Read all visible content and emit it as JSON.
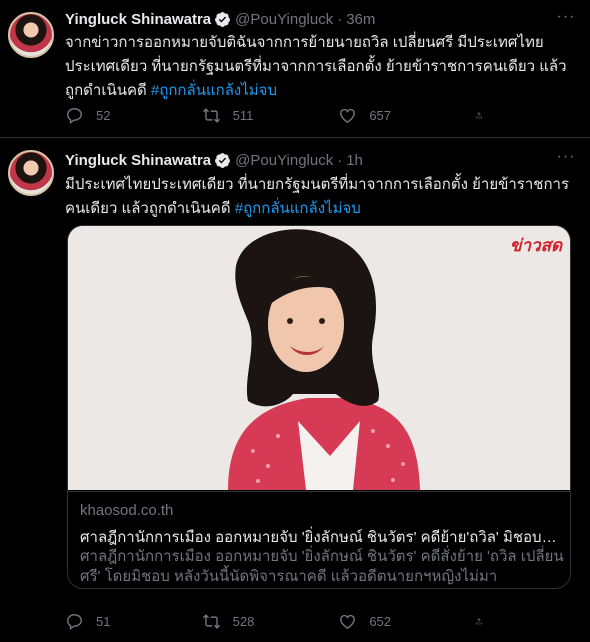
{
  "tweets": [
    {
      "name": "Yingluck Shinawatra",
      "handle": "@PouYingluck",
      "separator": "·",
      "time": "36m",
      "text": "จากข่าวการออกหมายจับติฉันจากการย้ายนายถวิล เปลี่ยนศรี มีประเทศไทยประเทศเดียว ที่นายกรัฐมนตรีที่มาจากการเลือกตั้ง ย้ายข้าราชการคนเดียว แล้วถูกดำเนินคดี",
      "hashtag": "#ถูกกลั่นแกล้งไม่จบ",
      "stats": {
        "replies": "52",
        "retweets": "511",
        "likes": "657"
      }
    },
    {
      "name": "Yingluck Shinawatra",
      "handle": "@PouYingluck",
      "separator": "·",
      "time": "1h",
      "text": "มีประเทศไทยประเทศเดียว ที่นายกรัฐมนตรีที่มาจากการเลือกตั้ง ย้ายข้าราชการคนเดียว แล้วถูกดำเนินคดี",
      "hashtag": "#ถูกกลั่นแกล้งไม่จบ",
      "card": {
        "brand": "ข่าวสด",
        "domain": "khaosod.co.th",
        "title": "ศาลฎีกานักการเมือง ออกหมายจับ 'ยิ่งลักษณ์ ชินวัตร' คดีย้าย'ถวิล' มิชอบ - ข่าวสด",
        "description": "ศาลฎีกานักการเมือง ออกหมายจับ 'ยิ่งลักษณ์ ชินวัตร' คดีสั่งย้าย 'ถวิล เปลี่ยนศรี' โดยมิชอบ หลังวันนี้นัดพิจารณาคดี แล้วอดีตนายกฯหญิงไม่มา"
      },
      "stats": {
        "replies": "51",
        "retweets": "528",
        "likes": "652"
      }
    }
  ],
  "icons": {
    "verified": "verified-badge-icon",
    "more": "more-options-icon",
    "reply": "reply-icon",
    "retweet": "retweet-icon",
    "like": "heart-icon",
    "share": "share-icon"
  },
  "colors": {
    "background": "#000000",
    "text": "#e7e9ea",
    "muted": "#71767b",
    "accent": "#1d9bf0",
    "border": "#2f3336"
  }
}
